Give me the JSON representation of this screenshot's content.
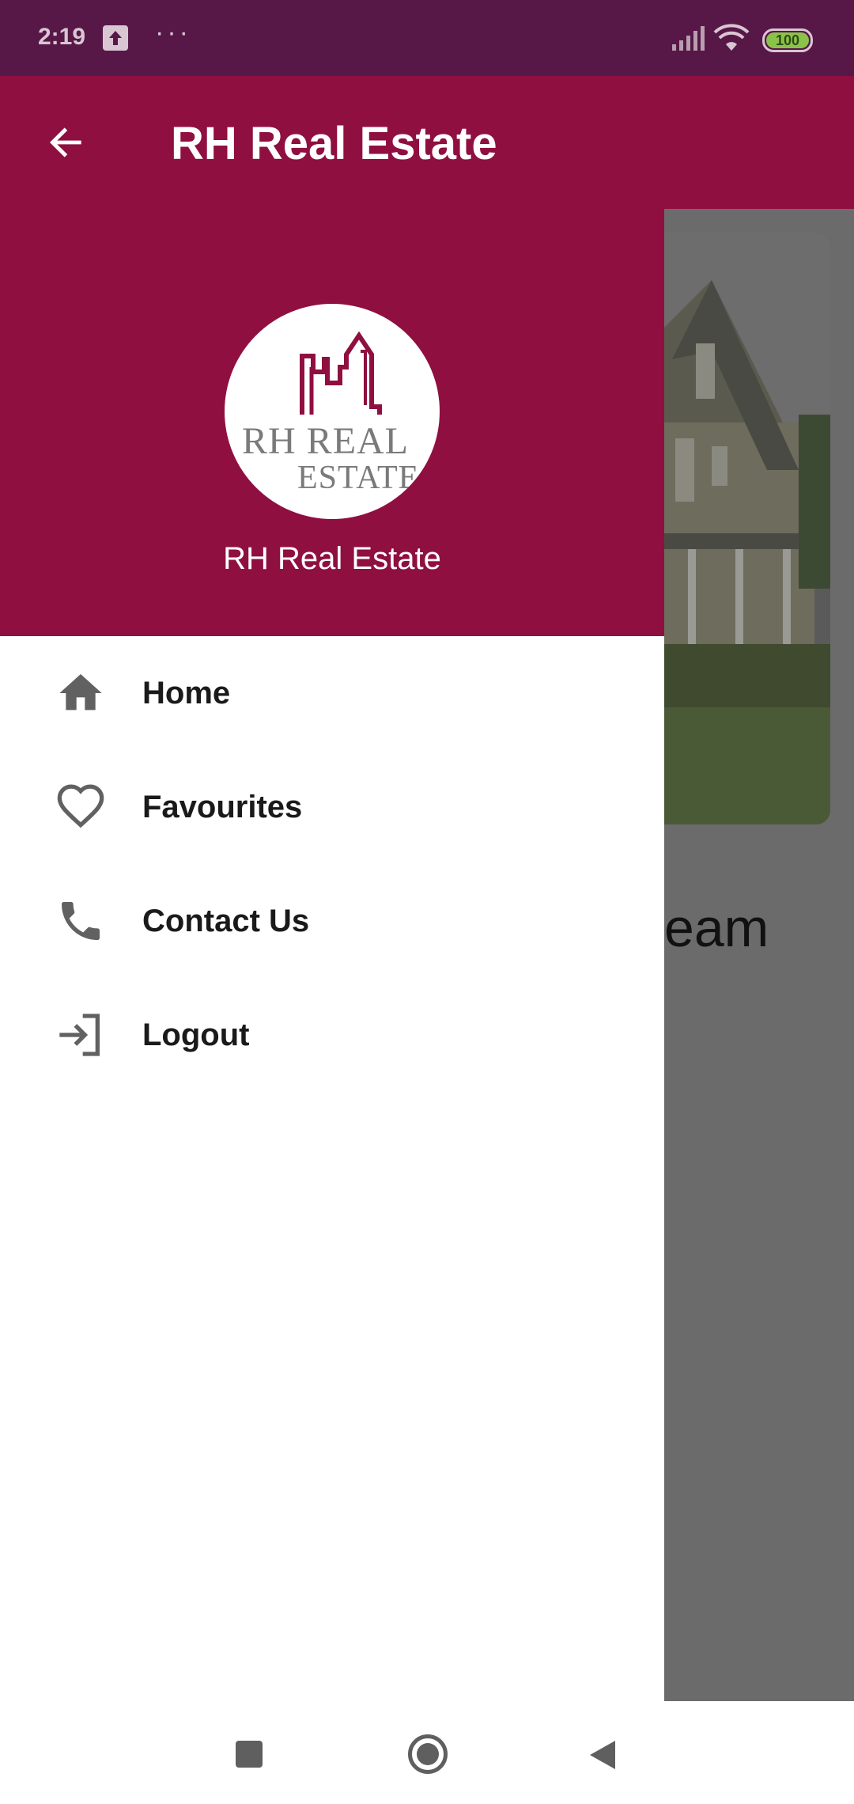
{
  "status_bar": {
    "time": "2:19",
    "dots": "···",
    "battery": "100",
    "icons": [
      "upload-icon",
      "signal-icon",
      "wifi-icon",
      "battery-icon"
    ]
  },
  "app_bar": {
    "title": "RH Real Estate",
    "back_icon": "arrow-back-icon"
  },
  "drawer": {
    "logo": {
      "line1": "RH REAL",
      "line2": "ESTATE"
    },
    "name": "RH Real Estate",
    "items": [
      {
        "label": "Home",
        "icon": "home-icon"
      },
      {
        "label": "Favourites",
        "icon": "heart-outline-icon"
      },
      {
        "label": "Contact Us",
        "icon": "phone-icon"
      },
      {
        "label": "Logout",
        "icon": "login-icon"
      }
    ]
  },
  "background": {
    "heading_fragment": "eam"
  },
  "colors": {
    "status_bar": "#571847",
    "primary": "#8f0f40",
    "scrim": "#6b6b6b",
    "icon": "#616161"
  },
  "nav_bar": {
    "icons": [
      "recents-icon",
      "home-nav-icon",
      "back-nav-icon"
    ]
  }
}
